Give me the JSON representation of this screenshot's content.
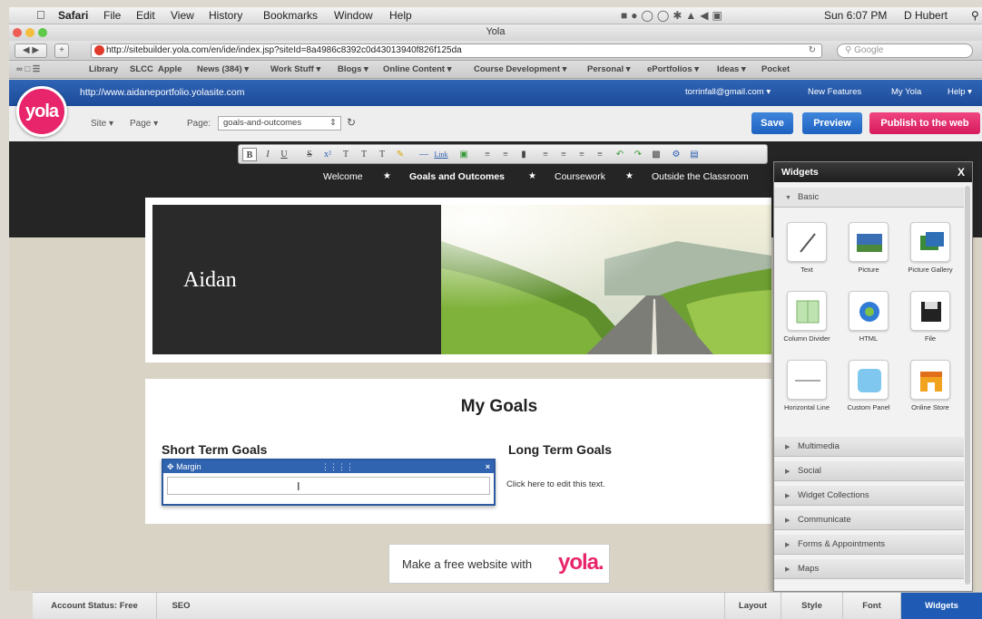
{
  "menubar": {
    "items": [
      "Safari",
      "File",
      "Edit",
      "View",
      "History",
      "Bookmarks",
      "Window",
      "Help"
    ],
    "clock": "Sun 6:07 PM",
    "user": "D Hubert"
  },
  "window": {
    "title": "Yola"
  },
  "address": {
    "url": "http://sitebuilder.yola.com/en/ide/index.jsp?siteId=8a4986c8392c0d43013940f826f125da",
    "search_placeholder": "Google"
  },
  "bookmarks": [
    "Library",
    "SLCC",
    "Apple",
    "News (384) ▾",
    "Work Stuff ▾",
    "Blogs ▾",
    "Online Content ▾",
    "Course Development ▾",
    "Personal ▾",
    "ePortfolios ▾",
    "Ideas ▾",
    "Pocket"
  ],
  "yola": {
    "logo": "yola",
    "site_url": "http://www.aidaneportfolio.yolasite.com",
    "email": "torrinfall@gmail.com ▾",
    "links": [
      "New Features",
      "My Yola",
      "Help ▾"
    ],
    "site_menu": "Site ▾",
    "page_menu": "Page ▾",
    "page_label": "Page:",
    "page_value": "goals-and-outcomes",
    "save": "Save",
    "preview": "Preview",
    "publish": "Publish to the web"
  },
  "site": {
    "nav": [
      "Welcome",
      "Goals and Outcomes",
      "Coursework",
      "Outside the Classroom"
    ],
    "banner_name": "Aidan",
    "heading": "My Goals",
    "short_term": "Short Term Goals",
    "long_term": "Long Term Goals",
    "long_term_text": "Click here to edit this text.",
    "margin_label": "Margin",
    "promo_text": "Make a free website with",
    "promo_logo": "yola."
  },
  "widgets": {
    "title": "Widgets",
    "close": "X",
    "basic": "Basic",
    "tiles": [
      "Text",
      "Picture",
      "Picture Gallery",
      "Column Divider",
      "HTML",
      "File",
      "Horizontal Line",
      "Custom Panel",
      "Online Store"
    ],
    "sections": [
      "Multimedia",
      "Social",
      "Widget Collections",
      "Communicate",
      "Forms & Appointments",
      "Maps"
    ]
  },
  "bottombar": {
    "account_status": "Account Status: Free",
    "seo": "SEO",
    "tabs": [
      "Layout",
      "Style",
      "Font",
      "Widgets"
    ]
  },
  "colors": {
    "accent": "#1c4b99",
    "publish": "#e8256a",
    "active_tab": "#1f5bb4"
  }
}
